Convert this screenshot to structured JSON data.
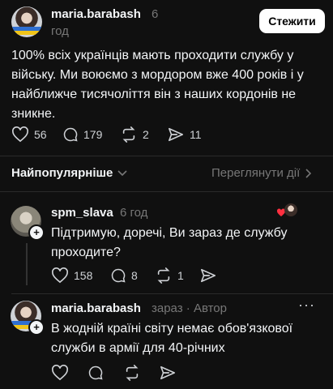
{
  "post": {
    "username": "maria.barabash",
    "time_value": "6",
    "time_unit": "год",
    "follow_label": "Стежити",
    "text": "100% всіх українців мають проходити службу у війську. Ми воюємо з мордором вже 400 років і у найближче тисячоліття він з наших кордонів не зникне.",
    "likes": "56",
    "comments": "179",
    "reposts": "2",
    "shares": "11"
  },
  "sort": {
    "label": "Найпопулярніше",
    "view_activity": "Переглянути дії"
  },
  "replies": [
    {
      "username": "spm_slava",
      "time": "6 год",
      "text": "Підтримую, доречі, Ви зараз де службу проходите?",
      "likes": "158",
      "comments": "8",
      "reposts": "1"
    },
    {
      "username": "maria.barabash",
      "time": "зараз · Автор",
      "text": "В жодній країні світу немає обов'язкової служби в армії для 40-річних"
    }
  ],
  "icons": {
    "heart": "heart-icon",
    "comment": "comment-icon",
    "repost": "repost-icon",
    "share": "share-icon"
  },
  "colors": {
    "background": "#101010",
    "text": "#f3f5f7",
    "muted": "#777777",
    "follow_button": "#ffffff"
  }
}
